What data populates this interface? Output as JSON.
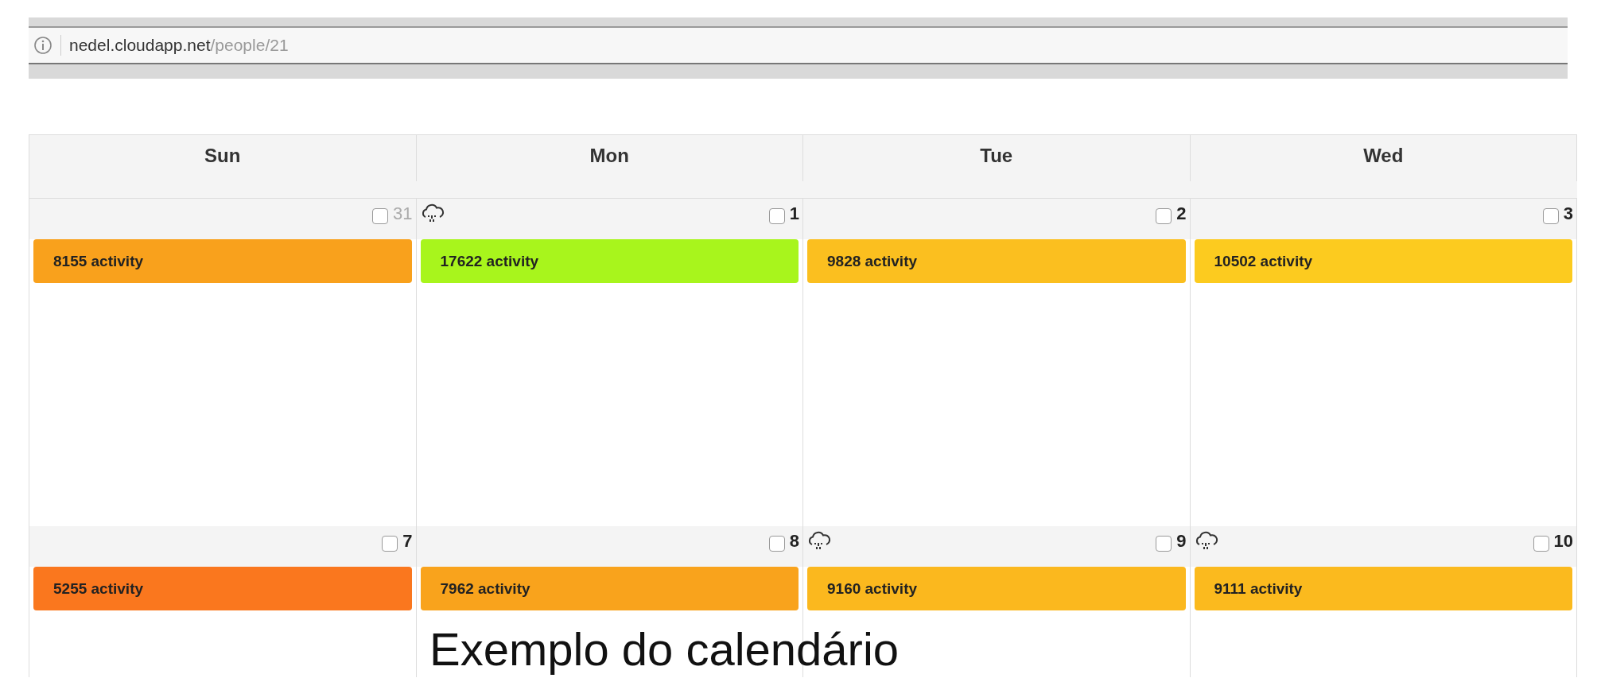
{
  "address_bar": {
    "domain": "nedel.cloudapp.net",
    "path": "/people/21"
  },
  "calendar": {
    "columns": [
      "Sun",
      "Mon",
      "Tue",
      "Wed"
    ],
    "weeks": [
      {
        "days": [
          {
            "date": "31",
            "other_month": true,
            "rain": false,
            "checked": false,
            "event": {
              "label": "8155 activity",
              "color": "#f9a11c"
            }
          },
          {
            "date": "1",
            "other_month": false,
            "rain": true,
            "checked": false,
            "event": {
              "label": "17622 activity",
              "color": "#a8f51c"
            }
          },
          {
            "date": "2",
            "other_month": false,
            "rain": false,
            "checked": false,
            "event": {
              "label": "9828 activity",
              "color": "#fbbf1f"
            }
          },
          {
            "date": "3",
            "other_month": false,
            "rain": false,
            "checked": false,
            "event": {
              "label": "10502 activity",
              "color": "#fccb1f"
            }
          }
        ]
      },
      {
        "days": [
          {
            "date": "7",
            "other_month": false,
            "rain": false,
            "checked": false,
            "event": {
              "label": "5255 activity",
              "color": "#fa771e"
            }
          },
          {
            "date": "8",
            "other_month": false,
            "rain": false,
            "checked": false,
            "event": {
              "label": "7962 activity",
              "color": "#f9a31c"
            }
          },
          {
            "date": "9",
            "other_month": false,
            "rain": true,
            "checked": false,
            "event": {
              "label": "9160 activity",
              "color": "#fbb81e"
            }
          },
          {
            "date": "10",
            "other_month": false,
            "rain": true,
            "checked": false,
            "event": {
              "label": "9111 activity",
              "color": "#fbba1e"
            }
          }
        ]
      }
    ]
  },
  "caption": "Exemplo do calendário"
}
